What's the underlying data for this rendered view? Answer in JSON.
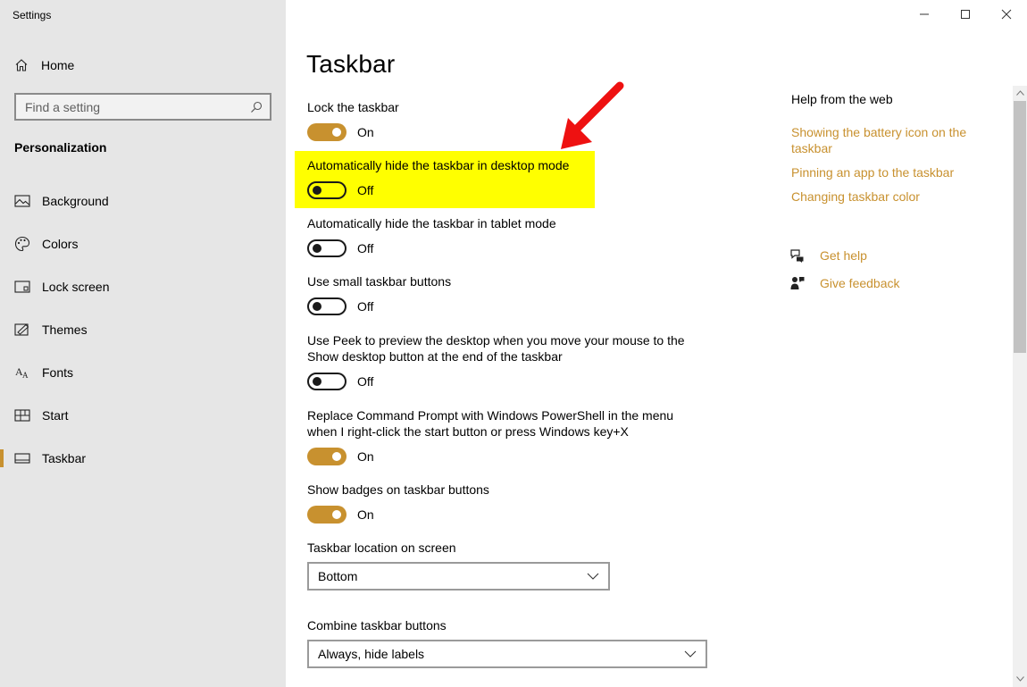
{
  "window": {
    "title": "Settings"
  },
  "sidebar": {
    "home_label": "Home",
    "search_placeholder": "Find a setting",
    "section_heading": "Personalization",
    "items": [
      {
        "label": "Background",
        "icon": "picture-icon"
      },
      {
        "label": "Colors",
        "icon": "palette-icon"
      },
      {
        "label": "Lock screen",
        "icon": "lock-screen-icon"
      },
      {
        "label": "Themes",
        "icon": "themes-icon"
      },
      {
        "label": "Fonts",
        "icon": "fonts-icon"
      },
      {
        "label": "Start",
        "icon": "start-icon"
      },
      {
        "label": "Taskbar",
        "icon": "taskbar-icon",
        "active": true
      }
    ]
  },
  "main": {
    "title": "Taskbar",
    "settings": [
      {
        "label": "Lock the taskbar",
        "state": "On"
      },
      {
        "label": "Automatically hide the taskbar in desktop mode",
        "state": "Off",
        "highlighted": true
      },
      {
        "label": "Automatically hide the taskbar in tablet mode",
        "state": "Off"
      },
      {
        "label": "Use small taskbar buttons",
        "state": "Off"
      },
      {
        "label": "Use Peek to preview the desktop when you move your mouse to the Show desktop button at the end of the taskbar",
        "state": "Off"
      },
      {
        "label": "Replace Command Prompt with Windows PowerShell in the menu when I right-click the start button or press Windows key+X",
        "state": "On"
      },
      {
        "label": "Show badges on taskbar buttons",
        "state": "On"
      }
    ],
    "location": {
      "label": "Taskbar location on screen",
      "value": "Bottom"
    },
    "combine": {
      "label": "Combine taskbar buttons",
      "value": "Always, hide labels"
    }
  },
  "help": {
    "title": "Help from the web",
    "links": [
      "Showing the battery icon on the taskbar",
      "Pinning an app to the taskbar",
      "Changing taskbar color"
    ],
    "get_help": "Get help",
    "give_feedback": "Give feedback"
  },
  "colors": {
    "accent": "#c8912f",
    "highlight": "#ffff00",
    "annotation_arrow": "#ee1111",
    "sidebar_bg": "#e6e6e6"
  }
}
